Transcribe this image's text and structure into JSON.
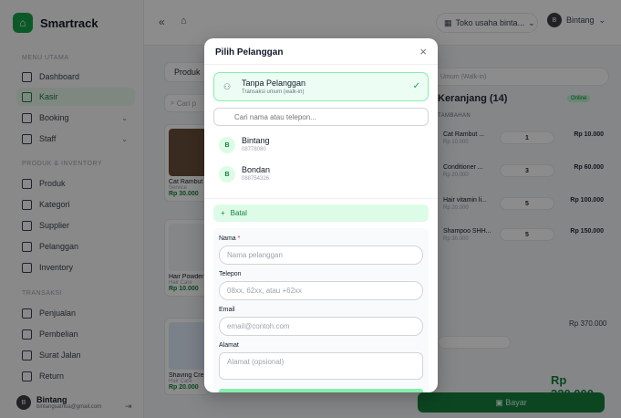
{
  "app": {
    "name": "Smartrack"
  },
  "sidebar": {
    "sections": [
      {
        "label": "MENU UTAMA"
      },
      {
        "label": "PRODUK & INVENTORY"
      },
      {
        "label": "TRANSAKSI"
      }
    ],
    "items": [
      {
        "label": "Dashboard",
        "icon": "home-icon"
      },
      {
        "label": "Kasir",
        "icon": "cart-icon",
        "active": true
      },
      {
        "label": "Booking",
        "icon": "calendar-icon",
        "chevron": "⌄"
      },
      {
        "label": "Staff",
        "icon": "users-icon",
        "chevron": "⌄"
      },
      {
        "label": "Produk",
        "icon": "box-icon"
      },
      {
        "label": "Kategori",
        "icon": "tag-icon"
      },
      {
        "label": "Supplier",
        "icon": "truck-icon"
      },
      {
        "label": "Pelanggan",
        "icon": "user-group-icon"
      },
      {
        "label": "Inventory",
        "icon": "package-icon"
      },
      {
        "label": "Penjualan",
        "icon": "bar-chart-icon"
      },
      {
        "label": "Pembelian",
        "icon": "receipt-icon"
      },
      {
        "label": "Surat Jalan",
        "icon": "truck-icon"
      },
      {
        "label": "Return",
        "icon": "return-icon"
      }
    ],
    "user": {
      "name": "Bintang",
      "email": "bintangsatrioa@gmail.com",
      "initial": "B"
    }
  },
  "topbar": {
    "collapse": "«",
    "home": "⌂",
    "store": "Toko usaha binta...",
    "store_chevron": "⌄",
    "user": "Bintang",
    "user_chevron": "⌄"
  },
  "main": {
    "tab": "Produk",
    "search_placeholder": "Cari p",
    "products": [
      {
        "name": "Cat Rambut",
        "sub": "Service",
        "price": "Rp 30.000"
      },
      {
        "name": "Hair Powder",
        "sub": "Hair Care",
        "price": "Rp 10.000"
      },
      {
        "name": "Shaving Cre",
        "sub": "Hair Care",
        "price": "Rp 20.000"
      }
    ]
  },
  "cart": {
    "walkin": "Umum (Walk-in)",
    "title": "Keranjang (14)",
    "online": "Online",
    "tambahan": "TAMBAHAN",
    "rows": [
      {
        "name": "Cat Rambut ...",
        "price": "Rp 10.000",
        "qty": "1",
        "total": "Rp 10.000"
      },
      {
        "name": "Conditioner ...",
        "price": "Rp 20.000",
        "qty": "3",
        "total": "Rp 60.000"
      },
      {
        "name": "Hair vitamin li...",
        "price": "Rp 20.000",
        "qty": "5",
        "total": "Rp 100.000"
      },
      {
        "name": "Shampoo SHH...",
        "price": "Rp 30.000",
        "qty": "5",
        "total": "Rp 150.000"
      }
    ],
    "subtotal": "Rp 370.000",
    "total": "Rp 320.000",
    "pay_label": "Bayar"
  },
  "modal": {
    "title": "Pilih Pelanggan",
    "close": "×",
    "walkin_title": "Tanpa Pelanggan",
    "walkin_sub": "Transaksi umum (walk-in)",
    "search_placeholder": "Cari nama atau telepon...",
    "customers": [
      {
        "initial": "B",
        "name": "Bintang",
        "phone": "08778080"
      },
      {
        "initial": "B",
        "name": "Bondan",
        "phone": "088754326"
      }
    ],
    "batal": "Batal",
    "form": {
      "name_label": "Nama",
      "name_required": "*",
      "name_placeholder": "Nama pelanggan",
      "phone_label": "Telepon",
      "phone_placeholder": "08xx, 62xx, atau +62xx",
      "email_label": "Email",
      "email_placeholder": "email@contoh.com",
      "address_label": "Alamat",
      "address_placeholder": "Alamat (opsional)"
    }
  },
  "colors": {
    "primary": "#16a34a",
    "primary_dark": "#15803d",
    "accent_light": "#dcfce7"
  }
}
